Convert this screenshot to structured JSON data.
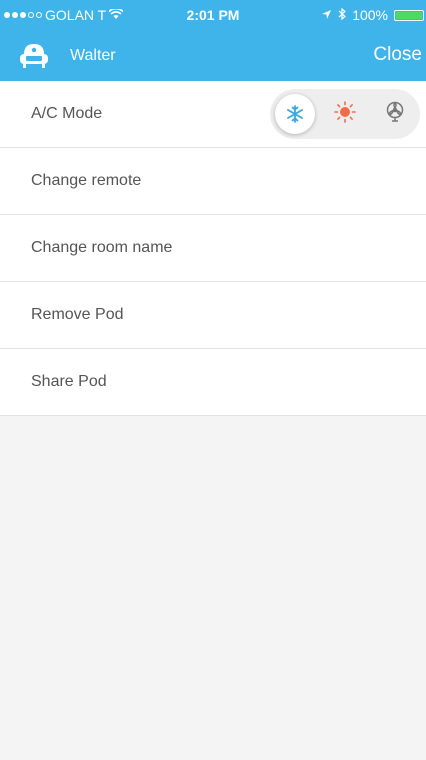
{
  "status_bar": {
    "carrier": "GOLAN T",
    "time": "2:01 PM",
    "battery": "100%",
    "battery_level": 1.0
  },
  "header": {
    "title": "Walter",
    "close_label": "Close"
  },
  "menu": {
    "ac_mode": {
      "label": "A/C Mode",
      "selected": "cool",
      "options": [
        {
          "name": "cool",
          "icon": "snowflake-icon"
        },
        {
          "name": "heat",
          "icon": "sun-icon"
        },
        {
          "name": "fan",
          "icon": "fan-icon"
        }
      ]
    },
    "items": [
      {
        "label": "Change remote"
      },
      {
        "label": "Change room name"
      },
      {
        "label": "Remove Pod"
      },
      {
        "label": "Share Pod"
      }
    ]
  },
  "colors": {
    "accent": "#3fb4ea",
    "heat": "#f26b4b",
    "battery": "#4cd964"
  }
}
